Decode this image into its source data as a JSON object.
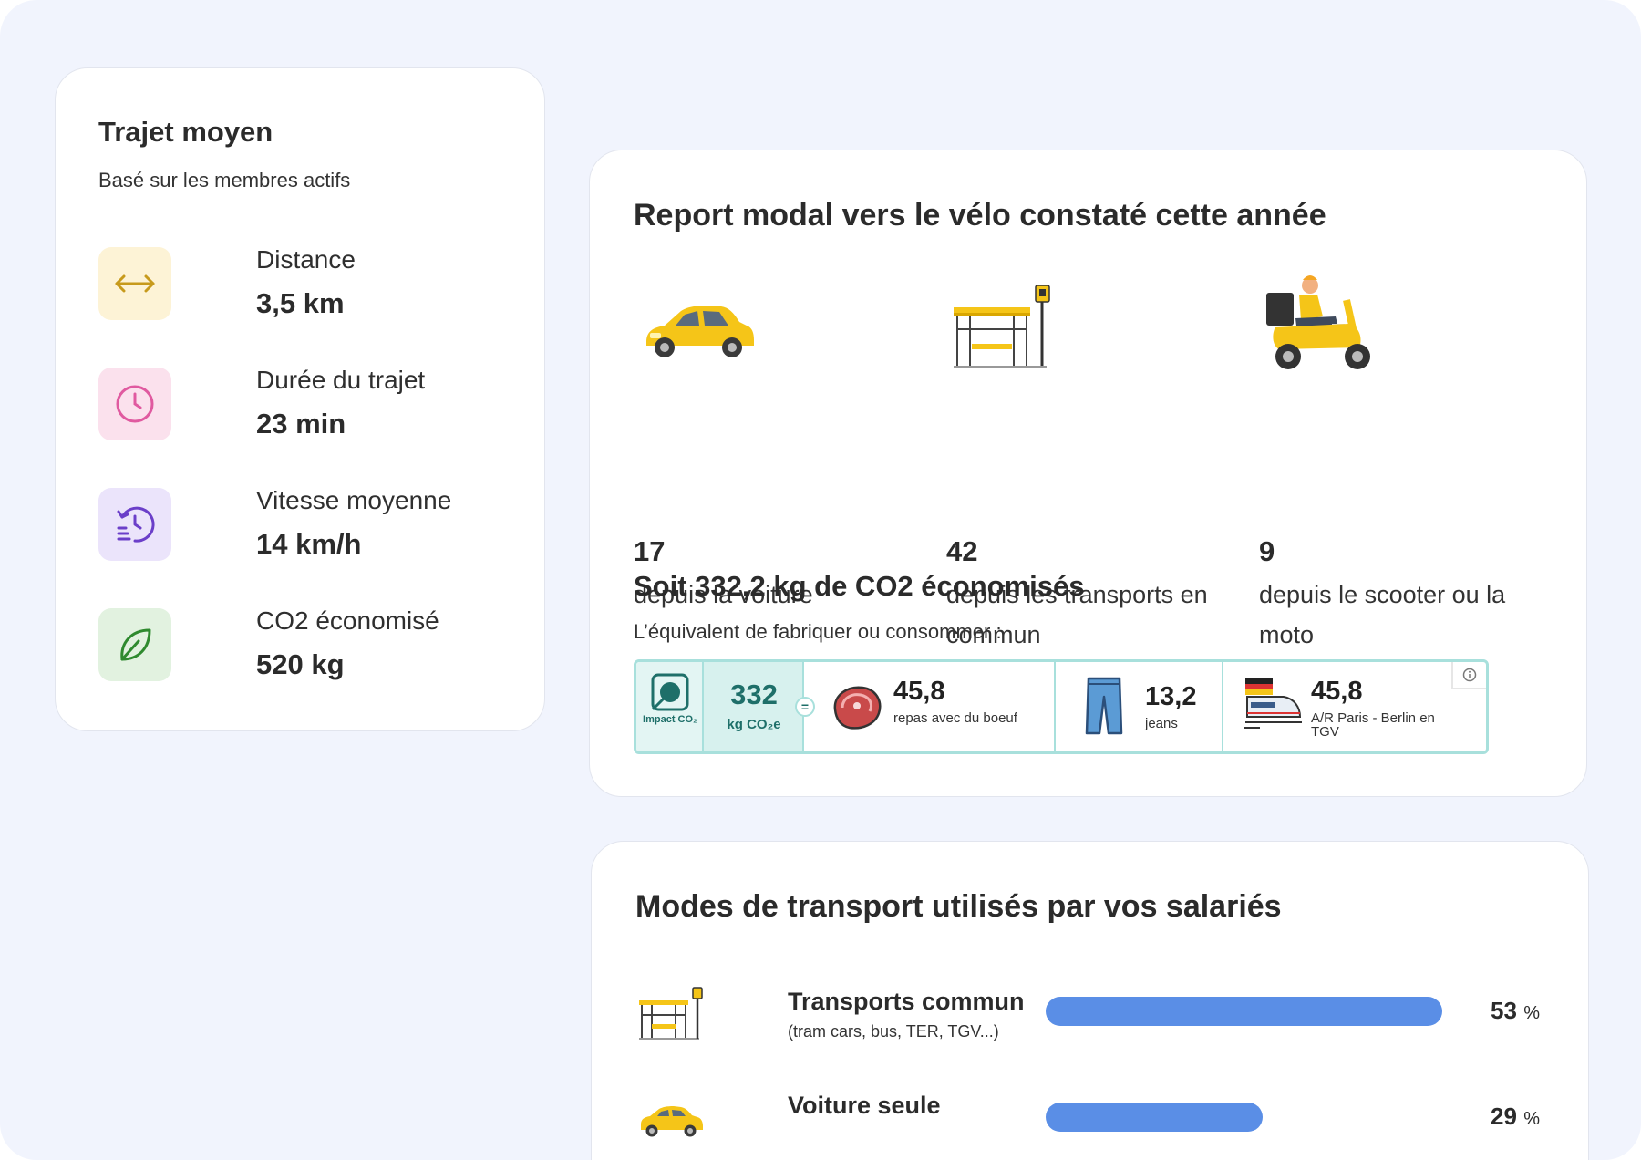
{
  "trip_card": {
    "title": "Trajet moyen",
    "subtitle": "Basé sur les membres actifs",
    "metrics": [
      {
        "label": "Distance",
        "value": "3,5 km",
        "icon": "horizontal-arrows-icon",
        "color": "#fdf3d6",
        "accent": "#c79a1c"
      },
      {
        "label": "Durée du trajet",
        "value": "23 min",
        "icon": "clock-icon",
        "color": "#fbe1ed",
        "accent": "#e05aa0"
      },
      {
        "label": "Vitesse moyenne",
        "value": "14 km/h",
        "icon": "speed-history-icon",
        "color": "#ebe4fb",
        "accent": "#6b3fc9"
      },
      {
        "label": "CO2 économisé",
        "value": "520 kg",
        "icon": "leaf-icon",
        "color": "#e2f2e0",
        "accent": "#2f8a2f"
      }
    ]
  },
  "modal_card": {
    "title": "Report modal vers le vélo constaté cette année",
    "shifts": [
      {
        "number": "17",
        "text": "depuis la voiture",
        "icon": "car-illustration"
      },
      {
        "number": "42",
        "text": "depuis les transports en commun",
        "icon": "bus-stop-illustration"
      },
      {
        "number": "9",
        "text": "depuis le scooter ou la moto",
        "icon": "scooter-illustration"
      }
    ],
    "co2_title": "Soit 332,2 kg de CO2 économisés",
    "co2_subtitle": "L’équivalent de fabriquer ou consommer :",
    "impact": {
      "logo_text": "Impact CO₂",
      "total": "332",
      "unit": "kg CO₂e",
      "equals": "=",
      "items": [
        {
          "value": "45,8",
          "label": "repas avec du boeuf",
          "icon": "steak-icon"
        },
        {
          "value": "13,2",
          "label": "jeans",
          "icon": "jeans-icon"
        },
        {
          "value": "45,8",
          "label": "A/R Paris - Berlin en TGV",
          "icon": "train-icon"
        }
      ]
    }
  },
  "modes_card": {
    "title": "Modes de transport utilisés par vos salariés",
    "modes": [
      {
        "label": "Transports commun",
        "sub": "(tram cars, bus, TER, TGV...)",
        "value": "53",
        "unit": "%",
        "fraction": 0.53,
        "icon": "bus-stop-icon"
      },
      {
        "label": "Voiture seule",
        "sub": "",
        "value": "29",
        "unit": "%",
        "fraction": 0.29,
        "icon": "car-icon"
      }
    ],
    "bar_color": "#5a8ee6"
  }
}
